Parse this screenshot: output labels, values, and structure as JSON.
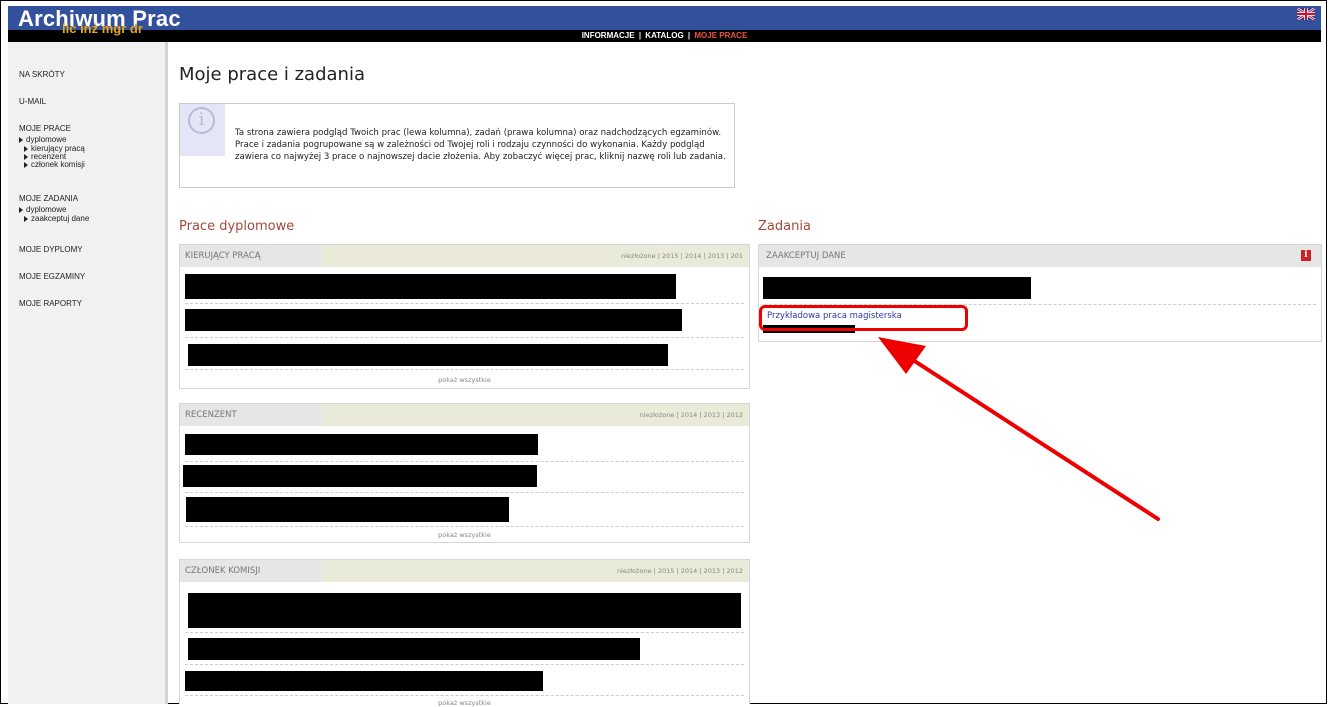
{
  "header": {
    "title": "Archiwum Prac",
    "subtitle": "lic inż mgr dr",
    "language_icon": "uk-flag-icon",
    "nav": [
      "INFORMACJE",
      "KATALOG",
      "MOJE PRACE"
    ],
    "nav_separator": "|",
    "active_nav": "MOJE PRACE",
    "active_color": "#ee5533"
  },
  "sidebar": {
    "na_skroty": "NA SKRÓTY",
    "umail": "U-MAIL",
    "moje_prace": "MOJE PRACE",
    "prace_dyplomowe": "dyplomowe",
    "kierujacy": "kierujący pracą",
    "recenzent": "recenzent",
    "czlonek": "członek komisji",
    "moje_zadania": "MOJE ZADANIA",
    "zadania_dyplomowe": "dyplomowe",
    "zaakceptuj": "zaakceptuj dane",
    "moje_dyplomy": "MOJE DYPLOMY",
    "moje_egzaminy": "MOJE EGZAMINY",
    "moje_raporty": "MOJE RAPORTY"
  },
  "main": {
    "title": "Moje prace i zadania",
    "info_text": "Ta strona zawiera podgląd Twoich prac (lewa kolumna), zadań (prawa kolumna) oraz nadchodzących egzaminów. Prace i zadania pogrupowane są w zależności od Twojej roli i rodzaju czynności do wykonania. Każdy podgląd zawiera co najwyżej 3 prace o najnowszej dacie złożenia. Aby zobaczyć więcej prac, kliknij nazwę roli lub zadania.",
    "prace_heading": "Prace dyplomowe",
    "zadania_heading": "Zadania",
    "panels": {
      "kierujacy": {
        "label": "KIERUJĄCY PRACĄ",
        "years": "niezłożone | 2015 | 2014 | 2013 | 201",
        "show_all": "pokaż wszystkie"
      },
      "recenzent": {
        "label": "RECENZENT",
        "years": "niezłożone | 2014 | 2013 | 2012",
        "show_all": "pokaż wszystkie"
      },
      "czlonek": {
        "label": "CZŁONEK KOMISJI",
        "years": "niezłożone | 2015 | 2014 | 2013 | 2012",
        "show_all": "pokaż wszystkie"
      }
    },
    "zadania_panel": {
      "label": "ZAAKCEPTUJ DANE",
      "warning_icon": "info-red-icon",
      "link": "Przykładowa praca magisterska"
    }
  },
  "annotation_color": "#ee0000"
}
